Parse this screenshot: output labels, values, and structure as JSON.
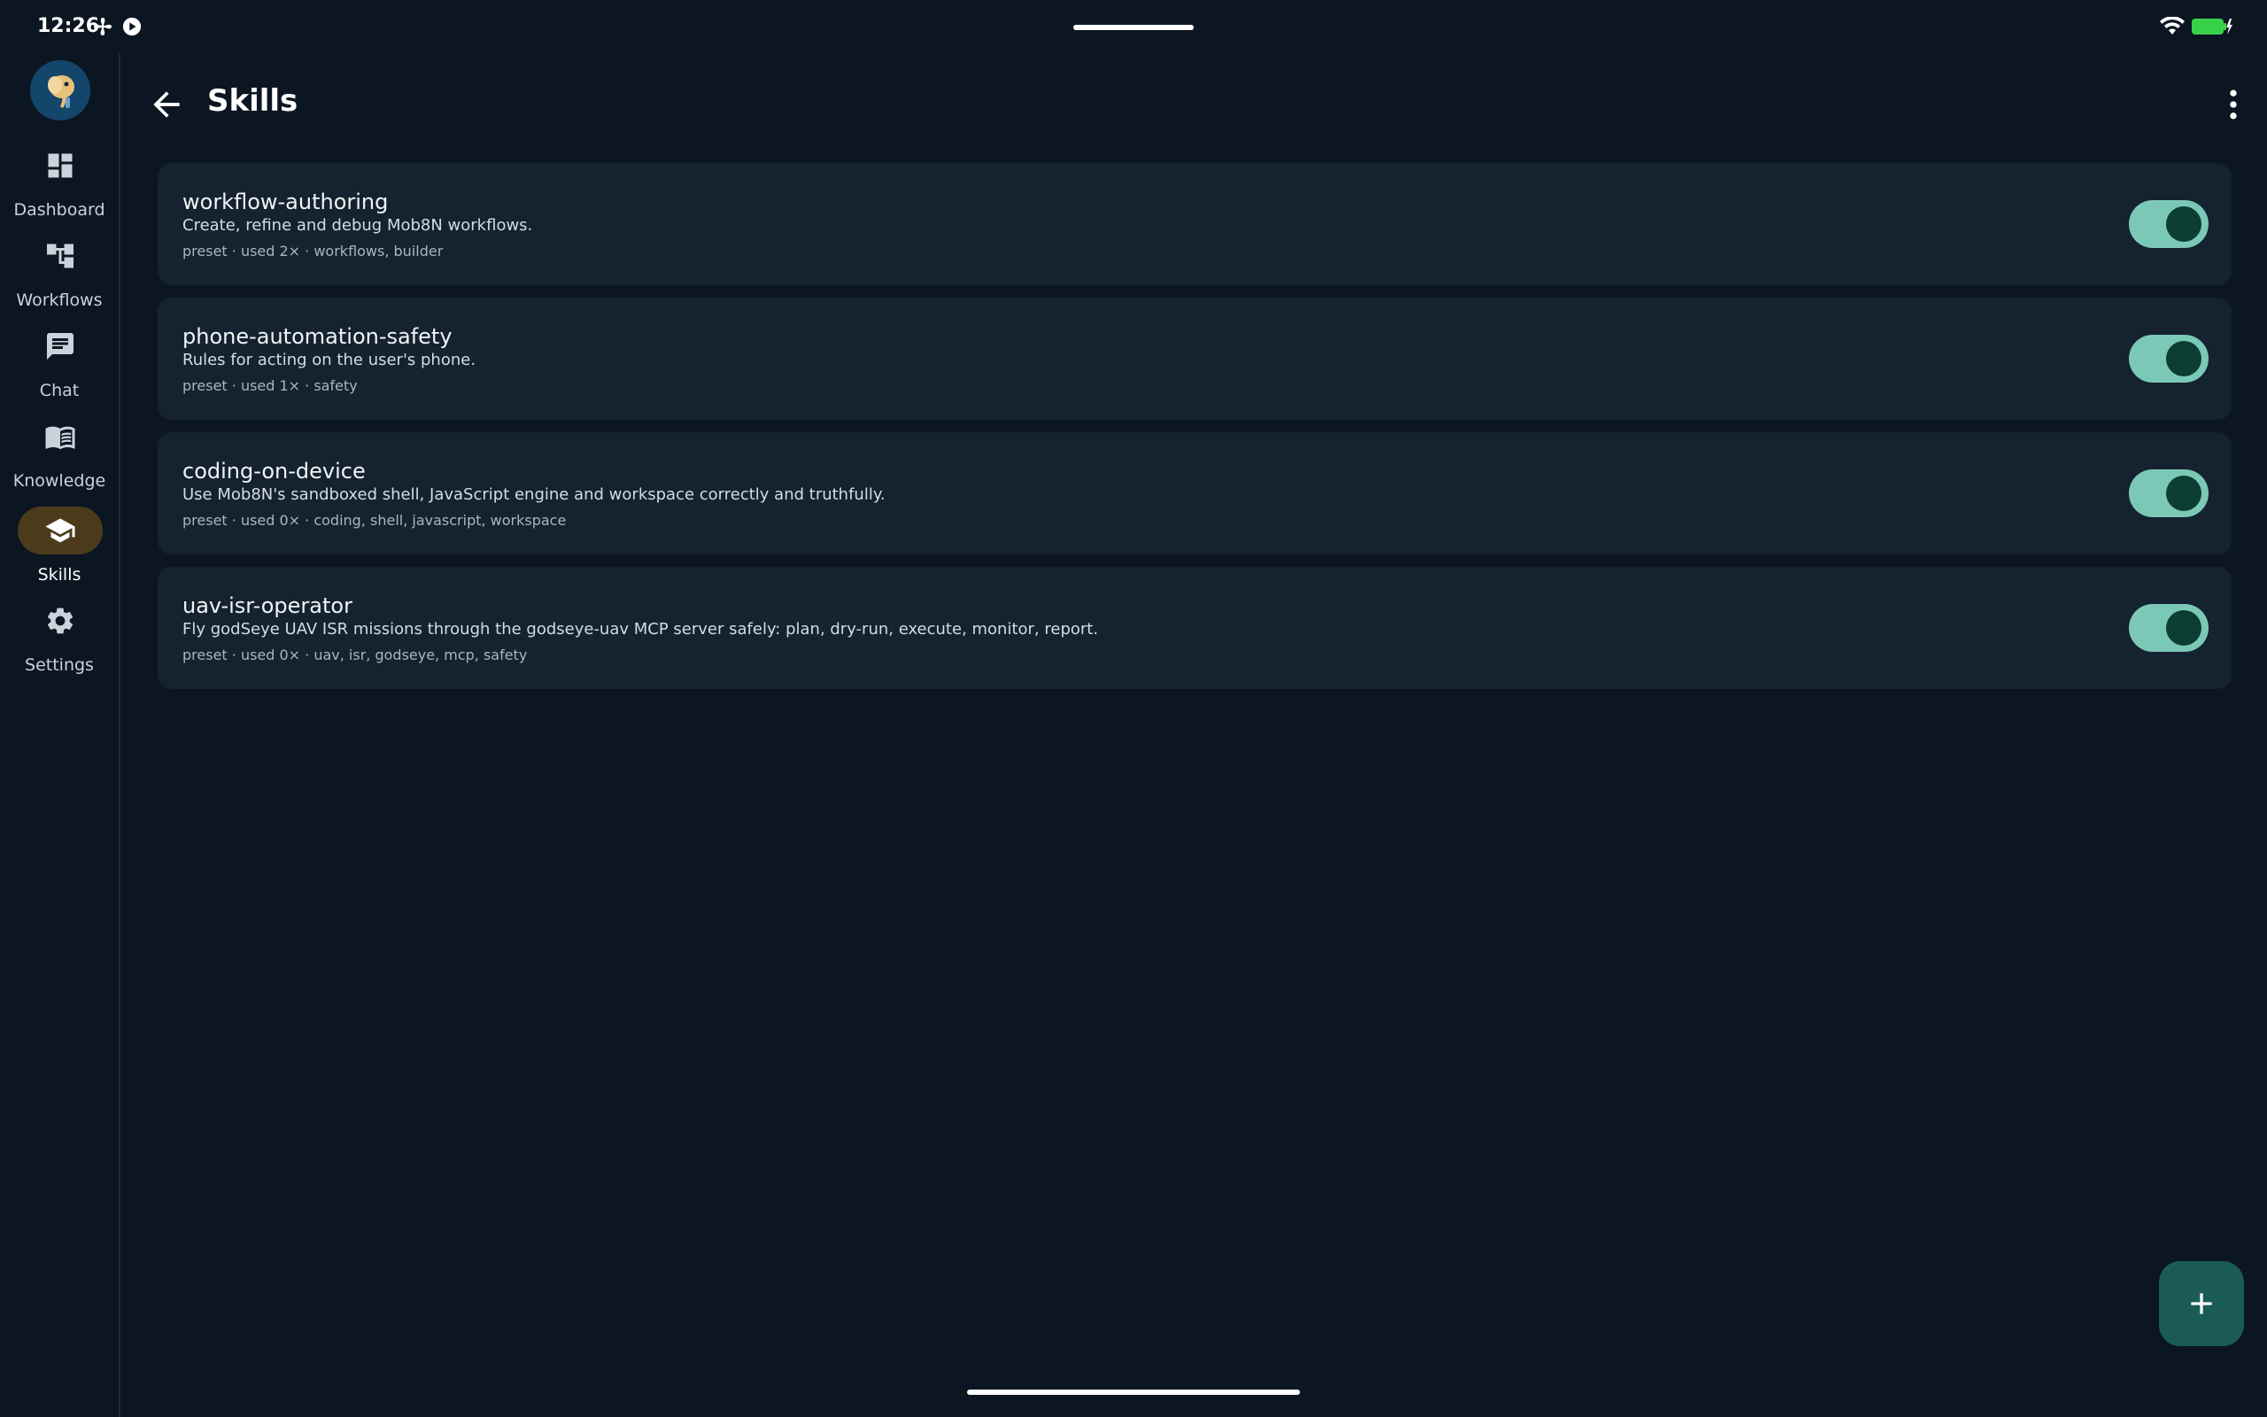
{
  "status_bar": {
    "time": "12:26",
    "icons": [
      "fan-icon",
      "play-icon",
      "wifi-icon",
      "battery-charging-icon"
    ],
    "battery_color": "#3ad14a"
  },
  "nav": {
    "items": [
      {
        "label": "Dashboard",
        "icon": "dashboard-icon",
        "active": false
      },
      {
        "label": "Workflows",
        "icon": "workflows-icon",
        "active": false
      },
      {
        "label": "Chat",
        "icon": "chat-icon",
        "active": false
      },
      {
        "label": "Knowledge",
        "icon": "knowledge-icon",
        "active": false
      },
      {
        "label": "Skills",
        "icon": "skills-icon",
        "active": true
      },
      {
        "label": "Settings",
        "icon": "settings-icon",
        "active": false
      }
    ]
  },
  "header": {
    "title": "Skills"
  },
  "skills": [
    {
      "name": "workflow-authoring",
      "description": "Create, refine and debug Mob8N workflows.",
      "meta": "preset · used 2× · workflows, builder",
      "enabled": true
    },
    {
      "name": "phone-automation-safety",
      "description": "Rules for acting on the user's phone.",
      "meta": "preset · used 1× · safety",
      "enabled": true
    },
    {
      "name": "coding-on-device",
      "description": "Use Mob8N's sandboxed shell, JavaScript engine and workspace correctly and truthfully.",
      "meta": "preset · used 0× · coding, shell, javascript, workspace",
      "enabled": true
    },
    {
      "name": "uav-isr-operator",
      "description": "Fly godSeye UAV ISR missions through the godseye-uav MCP server safely: plan, dry-run, execute, monitor, report.",
      "meta": "preset · used 0× · uav, isr, godseye, mcp, safety",
      "enabled": true
    }
  ],
  "colors": {
    "background": "#0c1622",
    "card": "#15222f",
    "toggle_track": "#7cc8b7",
    "toggle_knob": "#0c3d33",
    "active_nav": "#4b3b1a",
    "fab": "#1a5c55"
  }
}
